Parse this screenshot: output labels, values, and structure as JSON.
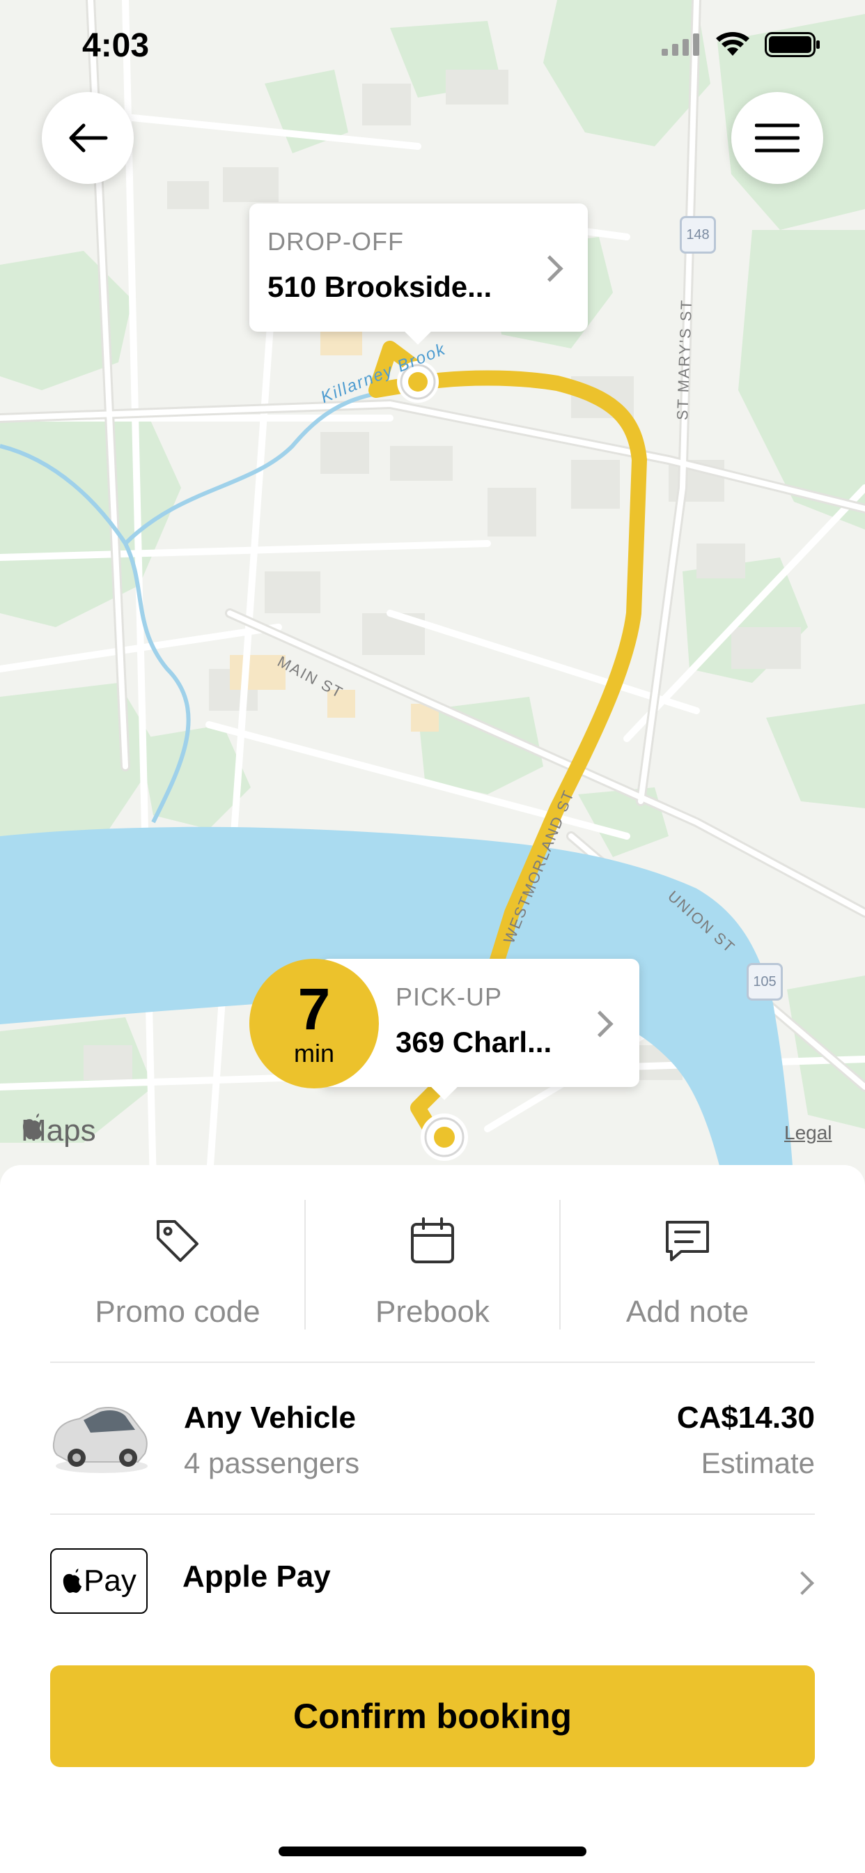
{
  "status_bar": {
    "time": "4:03"
  },
  "map": {
    "street_labels": {
      "main_st": "MAIN ST",
      "westmorland_st": "WESTMORLAND ST",
      "union_st": "UNION ST",
      "st_marys_st": "ST MARY'S ST"
    },
    "water_label": "Killarney Brook",
    "route_shields": [
      "148",
      "105"
    ],
    "attribution": "Maps",
    "legal": "Legal",
    "partial_place_label": "n",
    "route_color": "#ecc22c",
    "water_color": "#aadbf0"
  },
  "dropoff": {
    "caption": "DROP-OFF",
    "address": "510 Brookside..."
  },
  "pickup": {
    "caption": "PICK-UP",
    "address": "369 Charl..."
  },
  "eta": {
    "value": "7",
    "unit": "min"
  },
  "actions": [
    {
      "label": "Promo code",
      "icon": "tag-icon"
    },
    {
      "label": "Prebook",
      "icon": "calendar-icon"
    },
    {
      "label": "Add note",
      "icon": "note-icon"
    }
  ],
  "vehicle": {
    "name": "Any Vehicle",
    "passengers": "4 passengers",
    "price": "CA$14.30",
    "price_note": "Estimate",
    "icon": "car-icon"
  },
  "payment": {
    "badge": "Pay",
    "method": "Apple Pay"
  },
  "confirm_label": "Confirm booking",
  "colors": {
    "accent": "#ecc22c"
  }
}
